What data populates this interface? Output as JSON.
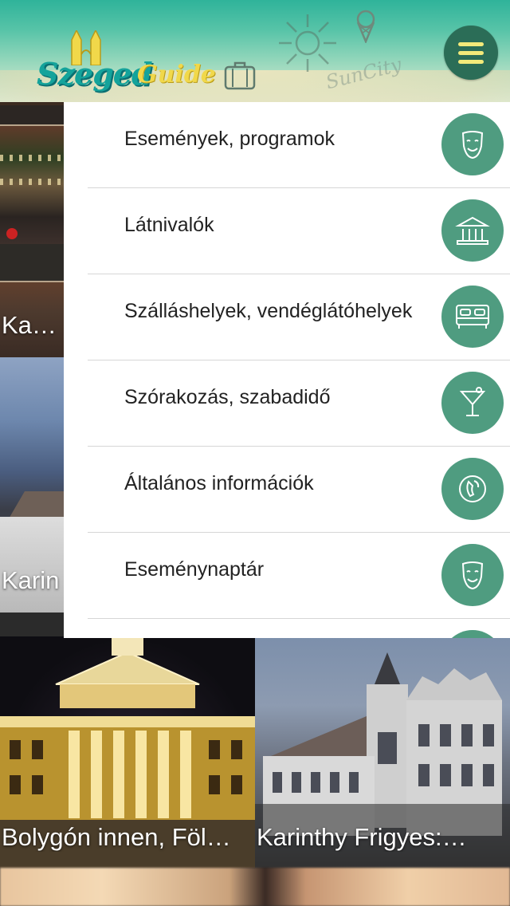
{
  "header": {
    "logo_text_primary": "Szeged",
    "logo_text_secondary": "Guide",
    "decor_text": "SunCity",
    "menu_button_icon": "hamburger-icon",
    "colors": {
      "menu_button_bg": "#2b6d57",
      "menu_button_bars": "#f3ea7a"
    }
  },
  "tiles": [
    {
      "caption": "Karác"
    },
    {
      "caption": "Karin"
    },
    {
      "caption": "Bolygón innen, Föl…"
    },
    {
      "caption": "Karinthy Frigyes:…"
    }
  ],
  "menu": {
    "items": [
      {
        "label": "Események, programok",
        "icon": "theater-mask-icon"
      },
      {
        "label": "Látnivalók",
        "icon": "museum-icon"
      },
      {
        "label": "Szálláshelyek, vendéglátóhelyek",
        "icon": "bed-icon"
      },
      {
        "label": "Szórakozás, szabadidő",
        "icon": "cocktail-icon"
      },
      {
        "label": "Általános információk",
        "icon": "phone-icon"
      },
      {
        "label": "Eseménynaptár",
        "icon": "theater-mask-icon"
      }
    ],
    "colors": {
      "icon_circle": "#4f9c80"
    }
  }
}
